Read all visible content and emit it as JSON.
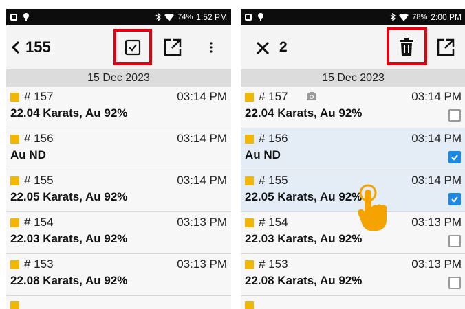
{
  "left": {
    "status": {
      "battery": "74%",
      "time": "1:52 PM"
    },
    "toolbar": {
      "back_icon": "chevron-left-icon",
      "title": "155",
      "select_icon": "checkbox-icon",
      "export_icon": "export-icon",
      "more_icon": "more-vert-icon"
    },
    "date_header": "15 Dec 2023",
    "items": [
      {
        "num": "# 157",
        "time": "03:14 PM",
        "desc": "22.04 Karats, Au 92%"
      },
      {
        "num": "# 156",
        "time": "03:14 PM",
        "desc": "Au ND"
      },
      {
        "num": "# 155",
        "time": "03:14 PM",
        "desc": "22.05 Karats, Au 92%"
      },
      {
        "num": "# 154",
        "time": "03:13 PM",
        "desc": "22.03 Karats, Au 92%"
      },
      {
        "num": "# 153",
        "time": "03:13 PM",
        "desc": "22.08 Karats, Au 92%"
      }
    ]
  },
  "right": {
    "status": {
      "battery": "78%",
      "time": "2:00 PM"
    },
    "toolbar": {
      "close_icon": "close-icon",
      "count": "2",
      "delete_icon": "trash-icon",
      "export_icon": "export-icon"
    },
    "date_header": "15 Dec 2023",
    "items": [
      {
        "num": "# 157",
        "time": "03:14 PM",
        "desc": "22.04 Karats, Au 92%",
        "checked": false,
        "camera": true
      },
      {
        "num": "# 156",
        "time": "03:14 PM",
        "desc": "Au ND",
        "checked": true
      },
      {
        "num": "# 155",
        "time": "03:14 PM",
        "desc": "22.05 Karats, Au 92%",
        "checked": true
      },
      {
        "num": "# 154",
        "time": "03:13 PM",
        "desc": "22.03 Karats, Au 92%",
        "checked": false
      },
      {
        "num": "# 153",
        "time": "03:13 PM",
        "desc": "22.08 Karats, Au 92%",
        "checked": false
      }
    ]
  },
  "colors": {
    "highlight": "#e3000f",
    "item_marker": "#f2b705",
    "checkbox_on": "#1e88e5",
    "hand": "#f5a300"
  }
}
